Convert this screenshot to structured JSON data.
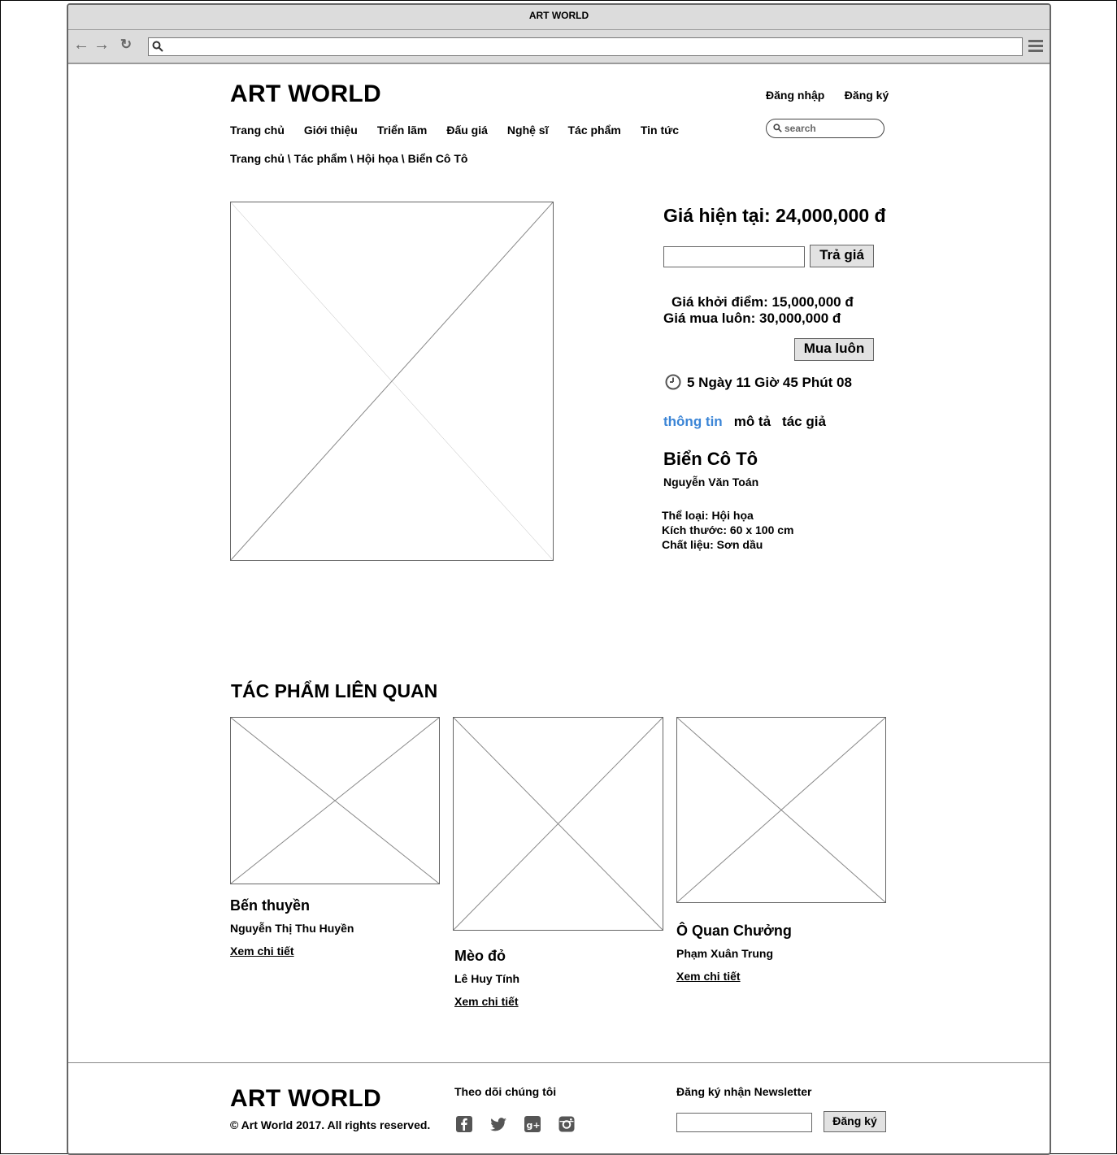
{
  "window": {
    "title": "ART WORLD"
  },
  "header": {
    "logo": "ART WORLD",
    "login": "Đăng nhập",
    "register": "Đăng ký",
    "search_placeholder": "search",
    "nav": [
      "Trang chủ",
      "Giới thiệu",
      "Triển lãm",
      "Đấu giá",
      "Nghệ sĩ",
      "Tác phẩm",
      "Tin tức"
    ],
    "breadcrumb": "Trang chủ \\ Tác phẩm \\ Hội họa \\ Biển Cô Tô"
  },
  "auction": {
    "current_price": "Giá hiện tại: 24,000,000 đ",
    "bid_button": "Trả giá",
    "start_price": "Giá khởi điểm: 15,000,000 đ",
    "buy_now_price": "Giá mua luôn: 30,000,000 đ",
    "buy_now_button": "Mua luôn",
    "countdown": "5 Ngày 11 Giờ 45 Phút 08"
  },
  "tabs": [
    {
      "label": "thông tin",
      "active": true
    },
    {
      "label": "mô tả",
      "active": false
    },
    {
      "label": "tác giả",
      "active": false
    }
  ],
  "artwork": {
    "title": "Biển Cô Tô",
    "artist": "Nguyễn Văn Toán",
    "category": "Thể loại: Hội họa",
    "size": "Kích thước: 60 x 100 cm",
    "material": "Chất liệu: Sơn dầu"
  },
  "related": {
    "heading": "TÁC PHẨM LIÊN QUAN",
    "items": [
      {
        "title": "Bến thuyền",
        "artist": "Nguyễn Thị Thu Huyền",
        "link": "Xem chi tiết"
      },
      {
        "title": "Mèo đỏ",
        "artist": "Lê Huy Tính",
        "link": "Xem chi tiết"
      },
      {
        "title": "Ô Quan Chưởng",
        "artist": "Phạm Xuân Trung",
        "link": "Xem chi tiết"
      }
    ]
  },
  "footer": {
    "logo": "ART WORLD",
    "copyright": "© Art World 2017. All rights reserved.",
    "follow": "Theo dõi chúng tôi",
    "newsletter": "Đăng ký nhận Newsletter",
    "newsletter_button": "Đăng ký",
    "social_icons": [
      "facebook-icon",
      "twitter-icon",
      "google-plus-icon",
      "instagram-icon"
    ]
  },
  "colors": {
    "active_tab": "#3b85d6",
    "chrome": "#dcdcdc"
  }
}
